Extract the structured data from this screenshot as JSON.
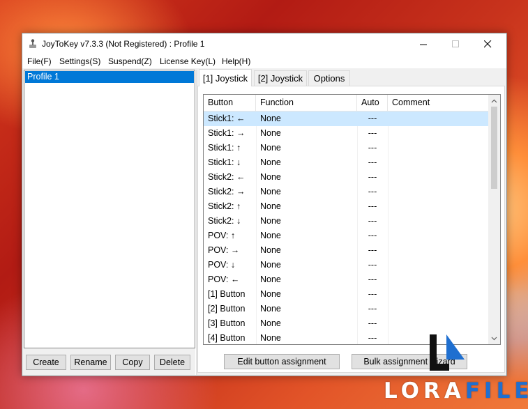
{
  "window": {
    "title": "JoyToKey v7.3.3 (Not Registered) : Profile 1",
    "controls": {
      "minimize": "—",
      "maximize": "☐",
      "close": "✕"
    }
  },
  "menu": [
    "File(F)",
    "Settings(S)",
    "Suspend(Z)",
    "License Key(L)",
    "Help(H)"
  ],
  "profiles": {
    "items": [
      "Profile 1"
    ],
    "selected": 0
  },
  "profile_buttons": {
    "create": "Create",
    "rename": "Rename",
    "copy": "Copy",
    "delete": "Delete"
  },
  "tabs": [
    {
      "label": "[1] Joystick",
      "active": true
    },
    {
      "label": "[2] Joystick",
      "active": false
    },
    {
      "label": "Options",
      "active": false
    }
  ],
  "table": {
    "columns": [
      "Button",
      "Function",
      "Auto",
      "Comment"
    ],
    "rows": [
      [
        "Stick1: ←",
        "None",
        "---",
        ""
      ],
      [
        "Stick1: →",
        "None",
        "---",
        ""
      ],
      [
        "Stick1: ↑",
        "None",
        "---",
        ""
      ],
      [
        "Stick1: ↓",
        "None",
        "---",
        ""
      ],
      [
        "Stick2: ←",
        "None",
        "---",
        ""
      ],
      [
        "Stick2: →",
        "None",
        "---",
        ""
      ],
      [
        "Stick2: ↑",
        "None",
        "---",
        ""
      ],
      [
        "Stick2: ↓",
        "None",
        "---",
        ""
      ],
      [
        "POV: ↑",
        "None",
        "---",
        ""
      ],
      [
        "POV: →",
        "None",
        "---",
        ""
      ],
      [
        "POV: ↓",
        "None",
        "---",
        ""
      ],
      [
        "POV: ←",
        "None",
        "---",
        ""
      ],
      [
        "[1] Button",
        "None",
        "---",
        ""
      ],
      [
        "[2] Button",
        "None",
        "---",
        ""
      ],
      [
        "[3] Button",
        "None",
        "---",
        ""
      ],
      [
        "[4] Button",
        "None",
        "---",
        ""
      ]
    ],
    "selected_row": 0
  },
  "scroll": {
    "up": "▲",
    "down": "▼"
  },
  "actions": {
    "edit": "Edit button assignment",
    "bulk": "Bulk assignment wizard"
  },
  "watermark": {
    "prefix": "LORA",
    "suffix": "FILE"
  },
  "colors": {
    "selection": "#0078d7",
    "row_highlight": "#cce8ff",
    "accent": "#1f6fd0"
  }
}
